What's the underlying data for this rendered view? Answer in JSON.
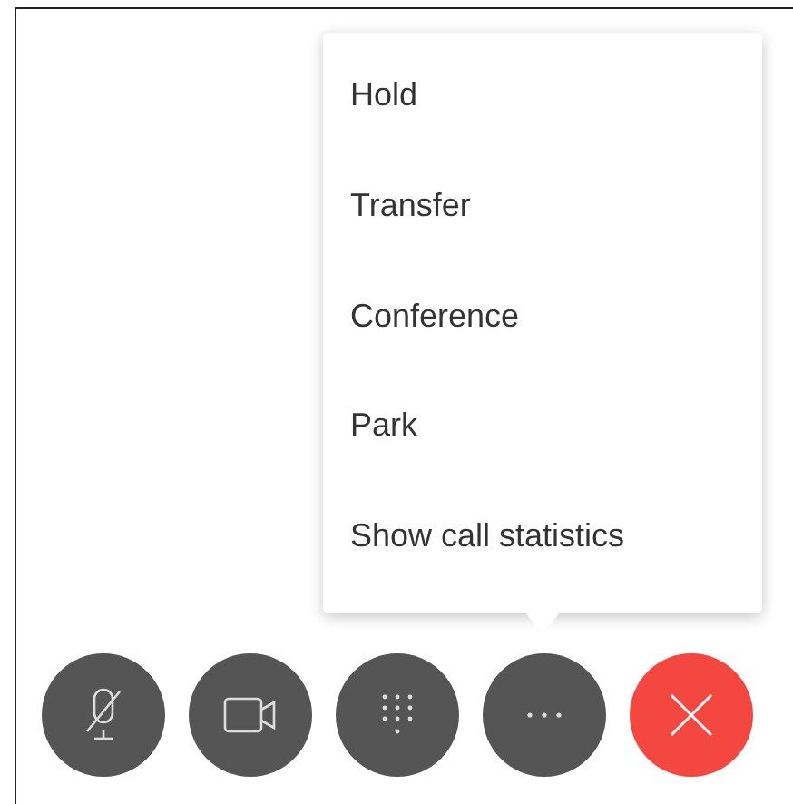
{
  "menu": {
    "items": [
      {
        "label": "Hold"
      },
      {
        "label": "Transfer"
      },
      {
        "label": "Conference"
      },
      {
        "label": "Park"
      },
      {
        "label": "Show call statistics"
      }
    ]
  },
  "controls": [
    {
      "kind": "mute"
    },
    {
      "kind": "video"
    },
    {
      "kind": "keypad"
    },
    {
      "kind": "more"
    },
    {
      "kind": "end"
    }
  ]
}
